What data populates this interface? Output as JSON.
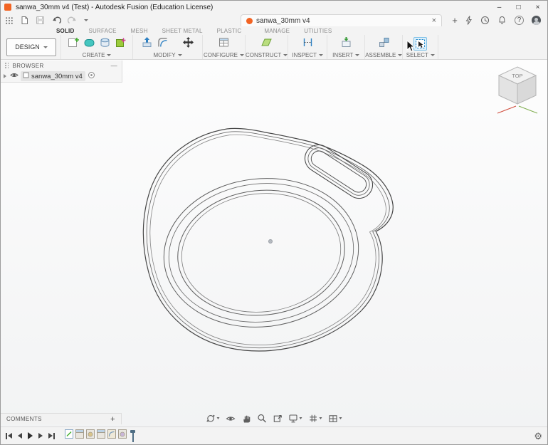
{
  "window": {
    "title": "sanwa_30mm v4 (Test) - Autodesk Fusion (Education License)",
    "minimize_glyph": "–",
    "maximize_glyph": "□",
    "close_glyph": "×"
  },
  "appbar": {
    "doc_tab_label": "sanwa_30mm v4",
    "tab_close_glyph": "×",
    "new_tab_glyph": "+",
    "help_glyph": "?"
  },
  "ribbon": {
    "design_label": "DESIGN",
    "tabs": [
      "SOLID",
      "SURFACE",
      "MESH",
      "SHEET METAL",
      "PLASTIC",
      "MANAGE",
      "UTILITIES"
    ],
    "active_tab": "SOLID",
    "groups": {
      "create": "CREATE",
      "modify": "MODIFY",
      "configure": "CONFIGURE",
      "construct": "CONSTRUCT",
      "inspect": "INSPECT",
      "insert": "INSERT",
      "assemble": "ASSEMBLE",
      "select": "SELECT"
    }
  },
  "browser": {
    "title": "BROWSER",
    "collapse_glyph": "—",
    "item_label": "sanwa_30mm v4"
  },
  "comments": {
    "title": "COMMENTS",
    "add_glyph": "+"
  },
  "viewcube": {
    "top_label": "TOP"
  },
  "statusbar": {
    "gear_glyph": "⚙"
  },
  "colors": {
    "accent_orange": "#f26322",
    "fusion_blue": "#0696d7",
    "hover_blue_bg": "#dff0fa",
    "hover_blue_border": "#7dc0e7"
  }
}
